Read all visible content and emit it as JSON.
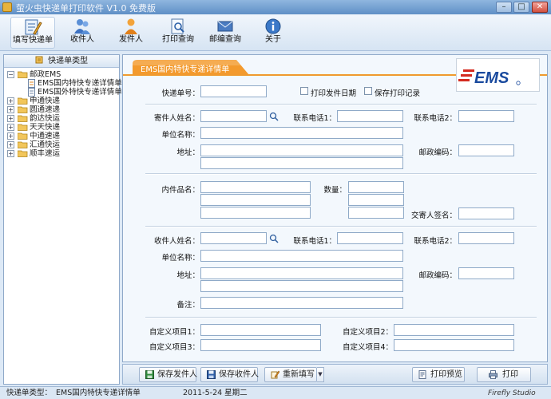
{
  "window": {
    "title": "萤火虫快递单打印软件  V1.0 免费版",
    "minimize_glyph": "–",
    "maximize_glyph": "□",
    "close_glyph": "✕"
  },
  "toolbar": {
    "items": [
      {
        "label": "填写快递单",
        "icon": "edit-form-icon"
      },
      {
        "label": "收件人",
        "icon": "recipients-icon"
      },
      {
        "label": "发件人",
        "icon": "sender-icon"
      },
      {
        "label": "打印查询",
        "icon": "print-query-icon"
      },
      {
        "label": "邮编查询",
        "icon": "postcode-query-icon"
      },
      {
        "label": "关于",
        "icon": "about-icon"
      }
    ]
  },
  "sidebar": {
    "header": "快递单类型",
    "tree": {
      "expander_open": "−",
      "expander_closed": "+",
      "nodes": [
        {
          "label": "邮政EMS"
        },
        {
          "label": "EMS国内特快专递详情单"
        },
        {
          "label": "EMS国外特快专递详情单"
        },
        {
          "label": "申通快递"
        },
        {
          "label": "圆通速递"
        },
        {
          "label": "韵达快运"
        },
        {
          "label": "天天快递"
        },
        {
          "label": "中通速递"
        },
        {
          "label": "汇通快运"
        },
        {
          "label": "顺丰速运"
        }
      ]
    }
  },
  "form": {
    "tab_title": "EMS国内特快专递详情单",
    "logo_text": "EMS",
    "tracking_no_label": "快递单号：",
    "print_send_date_label": "打印发件日期",
    "save_print_record_label": "保存打印记录",
    "sender": {
      "name_label": "寄件人姓名：",
      "phone1_label": "联系电话1：",
      "phone2_label": "联系电话2：",
      "company_label": "单位名称：",
      "address_label": "地址：",
      "postcode_label": "邮政编码："
    },
    "contents": {
      "item_name_label": "内件品名：",
      "quantity_label": "数量：",
      "signature_label": "交寄人签名："
    },
    "recipient": {
      "name_label": "收件人姓名：",
      "phone1_label": "联系电话1：",
      "phone2_label": "联系电话2：",
      "company_label": "单位名称：",
      "address_label": "地址：",
      "postcode_label": "邮政编码：",
      "notes_label": "备注："
    },
    "custom": {
      "item1_label": "自定义项目1：",
      "item2_label": "自定义项目2：",
      "item3_label": "自定义项目3：",
      "item4_label": "自定义项目4："
    }
  },
  "actions": {
    "save_sender": "保存发件人",
    "save_recipient": "保存收件人",
    "reset": "重新填写",
    "print_preview": "打印预览",
    "print": "打印"
  },
  "status": {
    "type_label": "快递单类型：",
    "type_value": "EMS国内特快专递详情单",
    "date": "2011-5-24 星期二",
    "brand": "Firefly Studio"
  },
  "colors": {
    "accent_orange": "#f09a2e",
    "ems_red": "#d42a1f",
    "ems_blue": "#1a4a9e"
  }
}
